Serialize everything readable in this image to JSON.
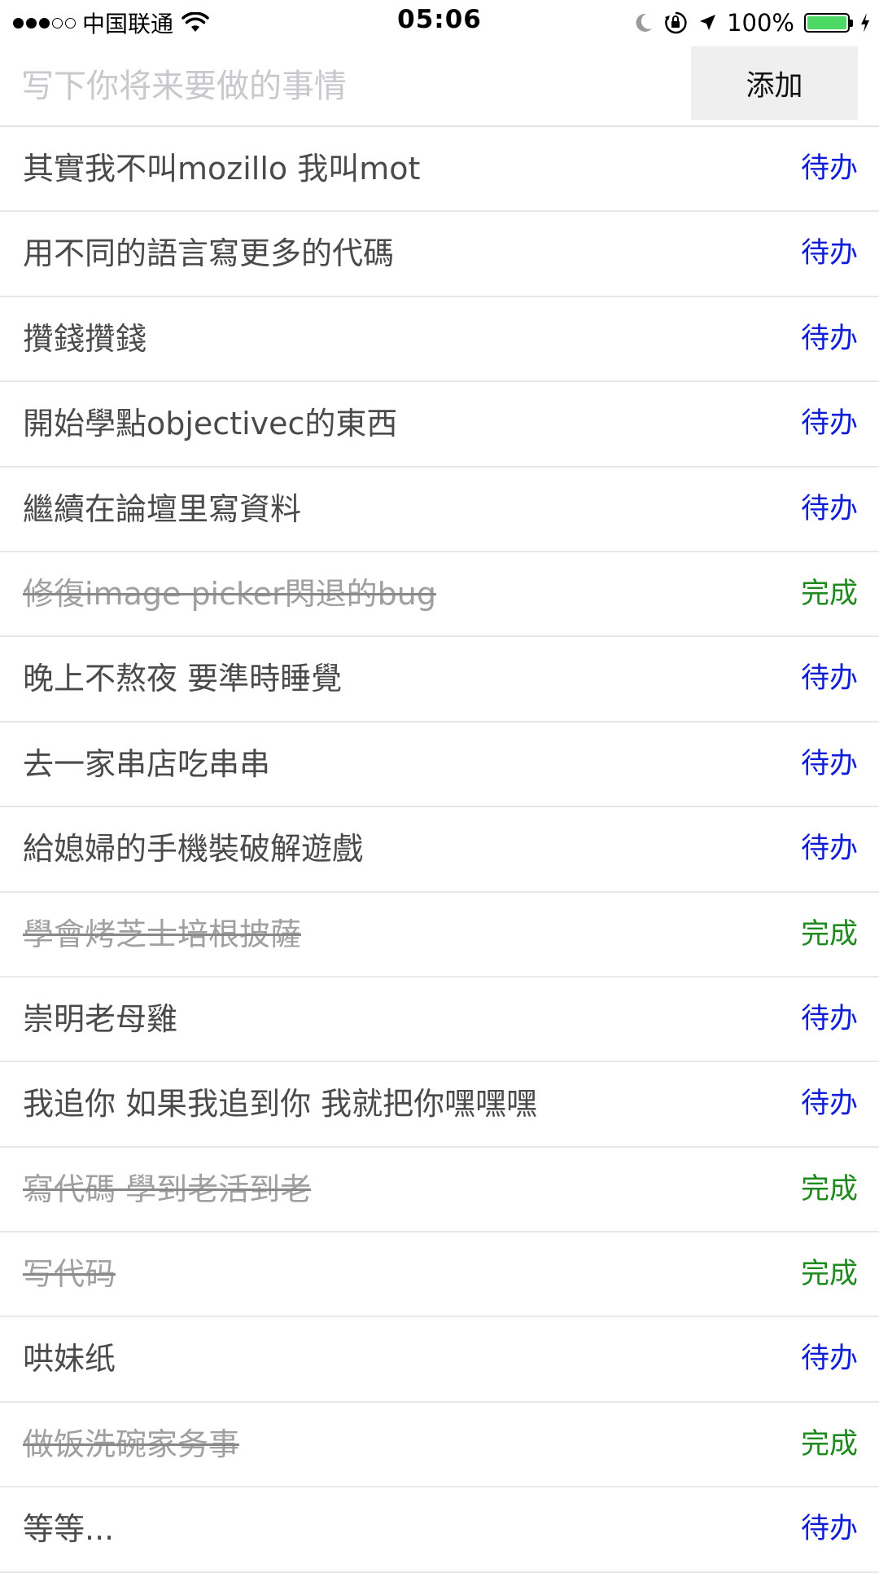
{
  "status_bar": {
    "carrier": "中国联通",
    "time": "05:06",
    "battery_percent": "100%",
    "battery_level": 1.0,
    "signal_bars": 3,
    "signal_total": 5,
    "icons": [
      "wifi-icon",
      "moon-icon",
      "orientation-lock-icon",
      "location-arrow-icon",
      "battery-icon",
      "charging-bolt-icon"
    ]
  },
  "input_bar": {
    "placeholder": "写下你将来要做的事情",
    "value": "",
    "add_label": "添加"
  },
  "colors": {
    "pending": "#0f1fd6",
    "done": "#1e8a1e",
    "battery_fill": "#4cd964",
    "button_bg": "#efefef"
  },
  "todos": [
    {
      "text": "其實我不叫mozillo 我叫mot",
      "status": "待办",
      "done": false
    },
    {
      "text": "用不同的語言寫更多的代碼",
      "status": "待办",
      "done": false
    },
    {
      "text": "攢錢攢錢",
      "status": "待办",
      "done": false
    },
    {
      "text": "開始學點objectivec的東西",
      "status": "待办",
      "done": false
    },
    {
      "text": "繼續在論壇里寫資料",
      "status": "待办",
      "done": false
    },
    {
      "text": "修復image picker閃退的bug",
      "status": "完成",
      "done": true
    },
    {
      "text": "晚上不熬夜 要準時睡覺",
      "status": "待办",
      "done": false
    },
    {
      "text": "去一家串店吃串串",
      "status": "待办",
      "done": false
    },
    {
      "text": "給媳婦的手機裝破解遊戲",
      "status": "待办",
      "done": false
    },
    {
      "text": "學會烤芝士培根披薩",
      "status": "完成",
      "done": true
    },
    {
      "text": "崇明老母雞",
      "status": "待办",
      "done": false
    },
    {
      "text": "我追你 如果我追到你 我就把你嘿嘿嘿",
      "status": "待办",
      "done": false
    },
    {
      "text": "寫代碼 學到老活到老",
      "status": "完成",
      "done": true
    },
    {
      "text": "写代码",
      "status": "完成",
      "done": true
    },
    {
      "text": "哄妹纸",
      "status": "待办",
      "done": false
    },
    {
      "text": "做饭洗碗家务事",
      "status": "完成",
      "done": true
    },
    {
      "text": "等等...",
      "status": "待办",
      "done": false
    }
  ]
}
